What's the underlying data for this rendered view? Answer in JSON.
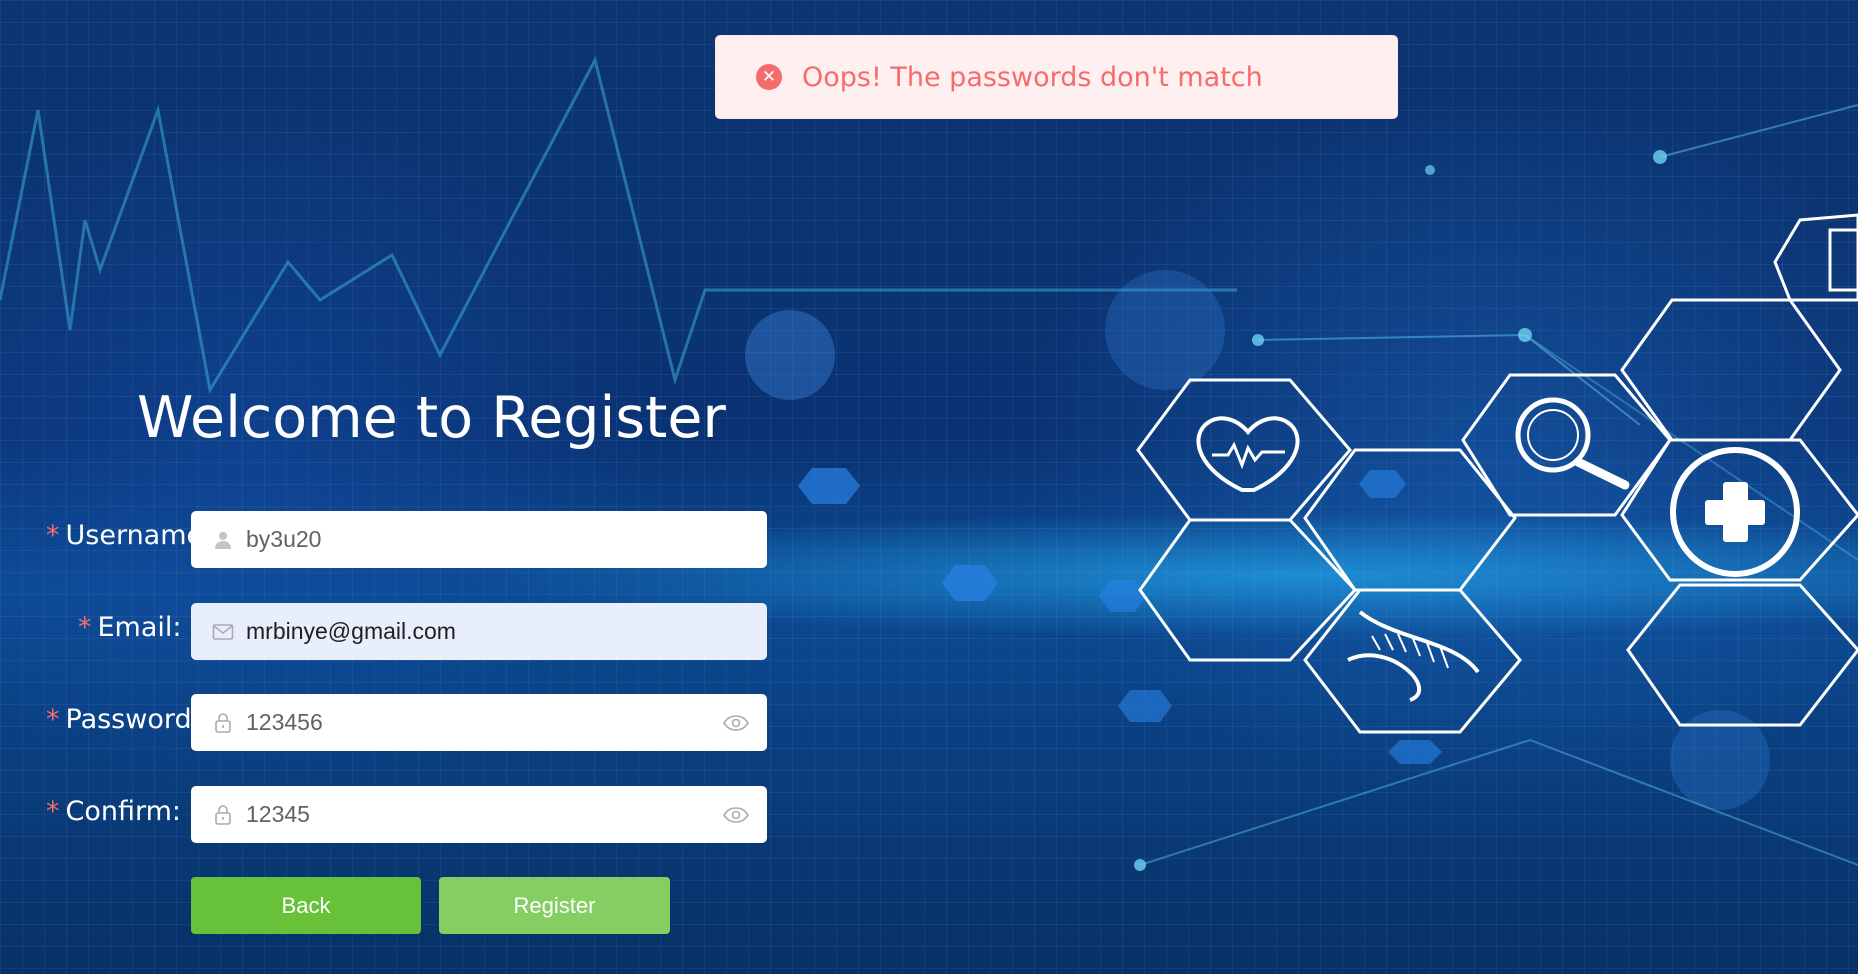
{
  "toast": {
    "type": "error",
    "icon": "close-circle-icon",
    "message": "Oops! The passwords don't match",
    "color": "#f56c6c",
    "background": "#fef0f0"
  },
  "page": {
    "title": "Welcome to Register"
  },
  "form": {
    "required_mark": "*",
    "username": {
      "label": "Username:",
      "icon": "user-icon",
      "value": "by3u20"
    },
    "email": {
      "label": "Email:",
      "icon": "mail-icon",
      "value": "mrbinye@gmail.com"
    },
    "password": {
      "label": "Password:",
      "icon": "lock-icon",
      "value": "123456",
      "toggle_icon": "eye-icon"
    },
    "confirm": {
      "label": "Confirm:",
      "icon": "lock-icon",
      "value": "12345",
      "toggle_icon": "eye-icon"
    }
  },
  "buttons": {
    "back_label": "Back",
    "register_label": "Register",
    "back_color": "#67c23a",
    "register_color": "#85ce61"
  }
}
